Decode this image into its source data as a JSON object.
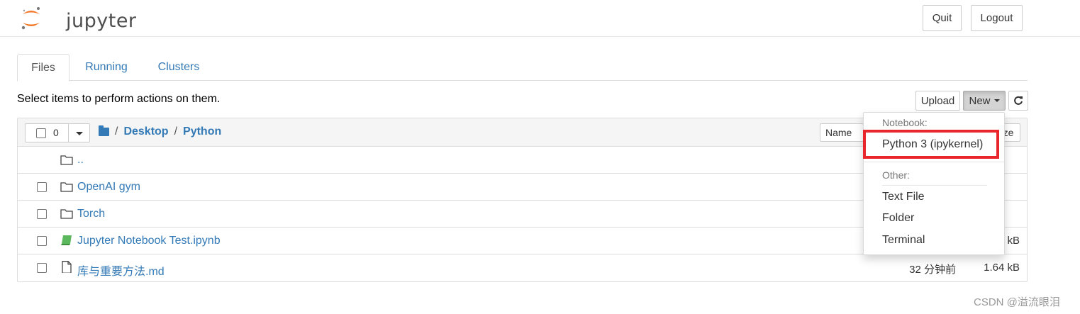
{
  "app": {
    "logo_text": "jupyter",
    "quit_label": "Quit",
    "logout_label": "Logout"
  },
  "tabs": [
    {
      "label": "Files",
      "active": true
    },
    {
      "label": "Running",
      "active": false
    },
    {
      "label": "Clusters",
      "active": false
    }
  ],
  "instructions": "Select items to perform actions on them.",
  "toolbar": {
    "upload_label": "Upload",
    "new_label": "New",
    "refresh_icon": "refresh-icon"
  },
  "list_header": {
    "selected_count": "0",
    "breadcrumb": [
      "Desktop",
      "Python"
    ],
    "name_sort_label": "Name",
    "size_sort_label": "ze"
  },
  "rows": [
    {
      "icon": "folder-icon",
      "name": "..",
      "modified": "",
      "size": "",
      "has_checkbox": false
    },
    {
      "icon": "folder-icon",
      "name": "OpenAI gym",
      "modified": "",
      "size": "",
      "has_checkbox": true
    },
    {
      "icon": "folder-icon",
      "name": "Torch",
      "modified": "",
      "size": "",
      "has_checkbox": true
    },
    {
      "icon": "notebook-icon",
      "name": "Jupyter Notebook Test.ipynb",
      "modified": "",
      "size": "kB",
      "has_checkbox": true
    },
    {
      "icon": "file-icon",
      "name": "库与重要方法.md",
      "modified": "32 分钟前",
      "size": "1.64 kB",
      "has_checkbox": true
    }
  ],
  "new_menu": {
    "notebook_header": "Notebook:",
    "notebook_items": [
      "Python 3 (ipykernel)"
    ],
    "other_header": "Other:",
    "other_items": [
      "Text File",
      "Folder",
      "Terminal"
    ]
  },
  "watermark": "CSDN @溢流眼泪",
  "colors": {
    "link": "#337ab7",
    "highlight_border": "#e8262b",
    "notebook_icon": "#5cb85c"
  }
}
